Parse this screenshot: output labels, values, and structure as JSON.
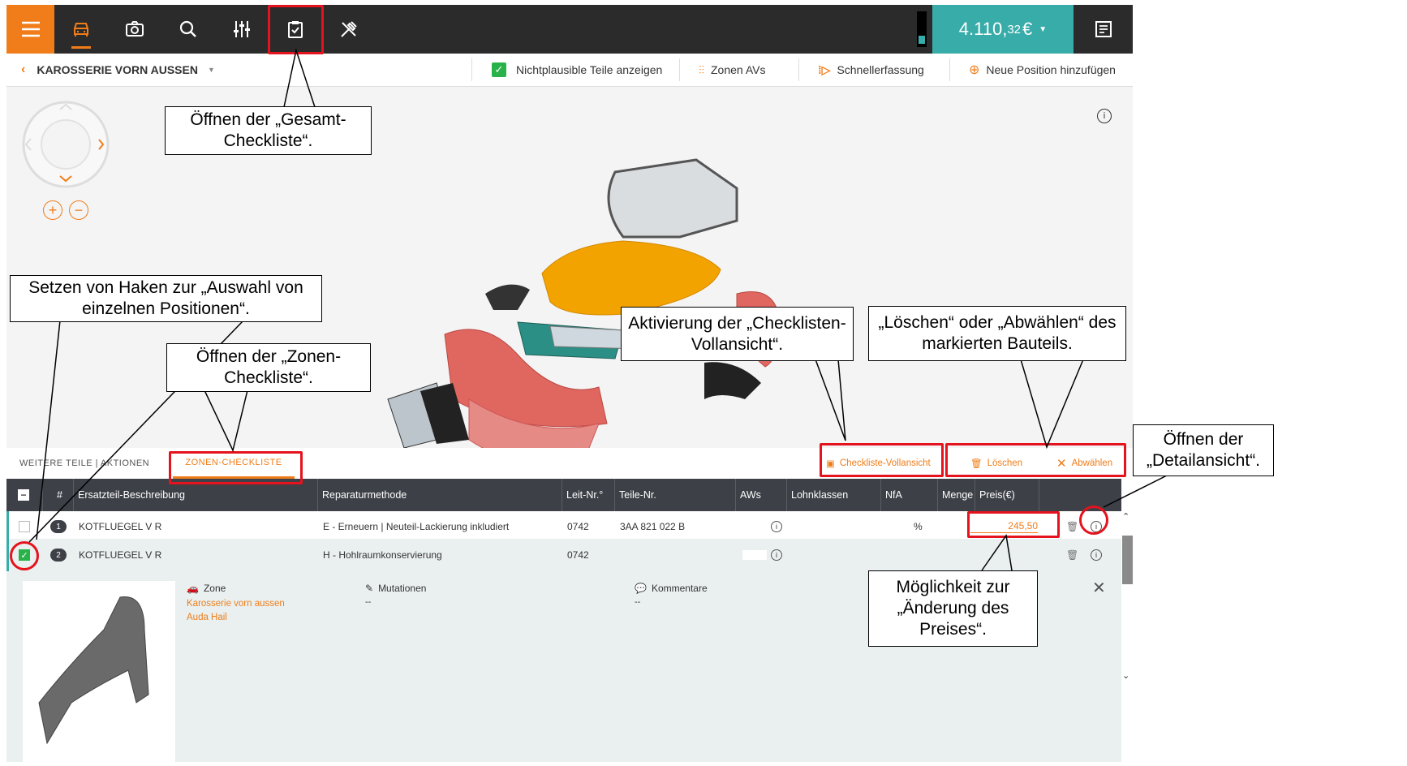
{
  "topbar": {
    "icons": [
      "menu-icon",
      "car-icon",
      "camera-icon",
      "search-icon",
      "sliders-icon",
      "clipboard-check-icon",
      "tools-icon"
    ],
    "price_main": "4.110,",
    "price_cents": "32",
    "price_currency": "€",
    "colors": {
      "bar": "#2b2b2b",
      "menu": "#f07d1a",
      "price": "#38aca8",
      "accent": "#e4131e"
    }
  },
  "subbar": {
    "zone_title": "KAROSSERIE VORN AUSSEN",
    "implausible_label": "Nichtplausible Teile anzeigen",
    "zones_avs_label": "Zonen AVs",
    "quick_entry_label": "Schnellerfassung",
    "new_position_label": "Neue Position hinzufügen"
  },
  "tabs": {
    "weitere_label": "WEITERE TEILE | AKTIONEN",
    "zonen_label": "ZONEN-CHECKLISTE",
    "full_view_label": "Checkliste-Vollansicht",
    "delete_label": "Löschen",
    "deselect_label": "Abwählen"
  },
  "table": {
    "headers": [
      "#",
      "Ersatzteil-Beschreibung",
      "Reparaturmethode",
      "Leit-Nr.°",
      "Teile-Nr.",
      "AWs",
      "Lohnklassen",
      "NfA",
      "Menge",
      "Preis(€)"
    ],
    "rows": [
      {
        "num": "1",
        "desc": "KOTFLUEGEL V R",
        "method": "E - Erneuern | Neuteil-Lackierung inkludiert",
        "leit": "0742",
        "teil": "3AA 821 022 B",
        "nfa": "%",
        "price": "245,50",
        "checked": false
      },
      {
        "num": "2",
        "desc": "KOTFLUEGEL V R",
        "method": "H - Hohlraumkonservierung",
        "leit": "0742",
        "teil": "",
        "nfa": "",
        "price": "",
        "checked": true
      }
    ]
  },
  "detail": {
    "zone_label": "Zone",
    "zone_value1": "Karosserie vorn aussen",
    "zone_value2": "Auda Hail",
    "mutations_label": "Mutationen",
    "mutations_value": "--",
    "comments_label": "Kommentare",
    "comments_value": "--"
  },
  "callouts": {
    "gesamt": "Öffnen der „Gesamt-Checkliste“.",
    "auswahl": "Setzen von Haken zur „Auswahl von einzelnen Positionen“.",
    "zonen": "Öffnen der „Zonen-Checkliste“.",
    "vollansicht": "Aktivierung der „Checklisten-Vollansicht“.",
    "loeschen": "„Löschen“ oder „Abwählen“ des markierten Bauteils.",
    "detail": "Öffnen der „Detailansicht“.",
    "preis": "Möglichkeit zur „Änderung des Preises“."
  }
}
